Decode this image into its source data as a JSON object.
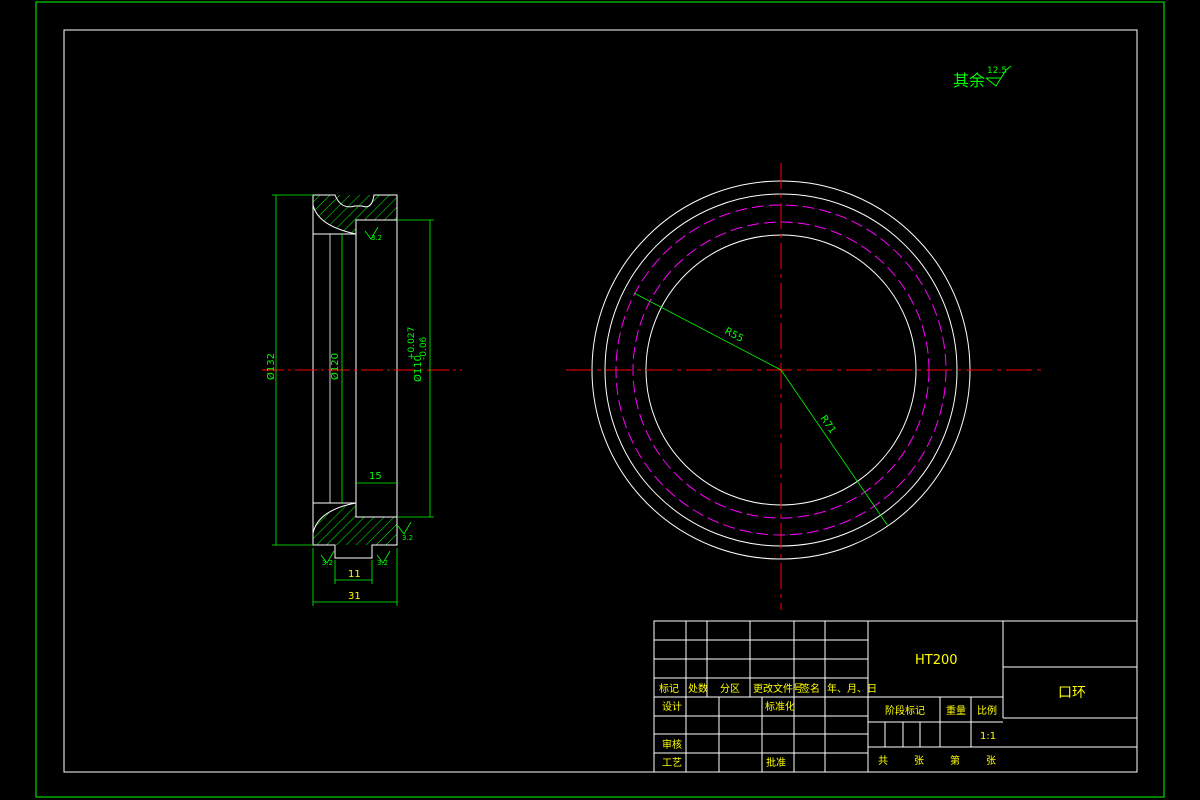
{
  "surface_note": {
    "prefix": "其余",
    "roughness": "12.5"
  },
  "section_view": {
    "dim_outer_diameter": "Ø132",
    "dim_inner_diameter": "Ø120",
    "dim_bore": "Ø110",
    "tol_upper": "+0.027",
    "tol_lower": "-0.06",
    "dim_width": "31",
    "dim_groove": "11",
    "dim_step": "15",
    "rough_top": "3.2",
    "rough_bl": "3.2",
    "rough_bc": "3.2",
    "rough_br": "3.2"
  },
  "front_view": {
    "radius_1": "R55",
    "radius_2": "R71"
  },
  "title_block": {
    "material": "HT200",
    "part_name": "口环",
    "hdr_mark": "标记",
    "hdr_count": "处数",
    "hdr_zone": "分区",
    "hdr_doc": "更改文件号",
    "hdr_sign": "签名",
    "hdr_date": "年、月、日",
    "lbl_design": "设计",
    "lbl_standard": "标准化",
    "lbl_check": "审核",
    "lbl_process": "工艺",
    "lbl_approve": "批准",
    "lbl_stage": "阶段标记",
    "lbl_weight": "重量",
    "lbl_scale": "比例",
    "scale_value": "1:1",
    "lbl_total": "共",
    "lbl_sheet1": "张",
    "lbl_page": "第",
    "lbl_sheet2": "张"
  },
  "colors": {
    "background": "#000000",
    "frame": "#00ff00",
    "outline": "#ffffff",
    "dimension": "#00ff00",
    "text_green": "#00ff00",
    "text_yellow": "#ffff00",
    "centerline": "#ff0000",
    "pitch_circle": "#ff00ff",
    "hatch": "#00ff00"
  }
}
